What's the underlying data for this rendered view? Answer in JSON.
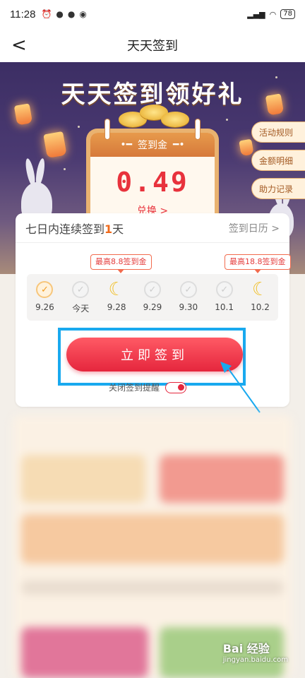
{
  "status_bar": {
    "time": "11:28",
    "battery": "78"
  },
  "nav": {
    "title": "天天签到",
    "back_icon": "chevron-left-icon"
  },
  "hero": {
    "headline": "天天签到领好礼",
    "calendar_label": "签到金",
    "amount": "0.49",
    "exchange": "兑换 >",
    "side_buttons": [
      "活动规则",
      "金额明细",
      "助力记录"
    ]
  },
  "checkin": {
    "title_prefix": "七日内连续签到",
    "streak": "1",
    "title_suffix": "天",
    "calendar_link": "签到日历 >",
    "bubbles": [
      "最高8.8签到金",
      "最高18.8签到金"
    ],
    "days": [
      {
        "label": "9.26",
        "state": "done"
      },
      {
        "label": "今天",
        "state": "pending"
      },
      {
        "label": "9.28",
        "state": "bonus"
      },
      {
        "label": "9.29",
        "state": "pending"
      },
      {
        "label": "9.30",
        "state": "pending"
      },
      {
        "label": "10.1",
        "state": "pending"
      },
      {
        "label": "10.2",
        "state": "bonus"
      }
    ],
    "sign_button": "立即签到",
    "remind_label": "关闭签到提醒"
  },
  "watermark": {
    "main": "Bai 经验",
    "sub": "jingyan.baidu.com"
  },
  "colors": {
    "accent_red": "#e5263d",
    "highlight_blue": "#19a9ef",
    "hero_bg": "#3c2e64"
  }
}
